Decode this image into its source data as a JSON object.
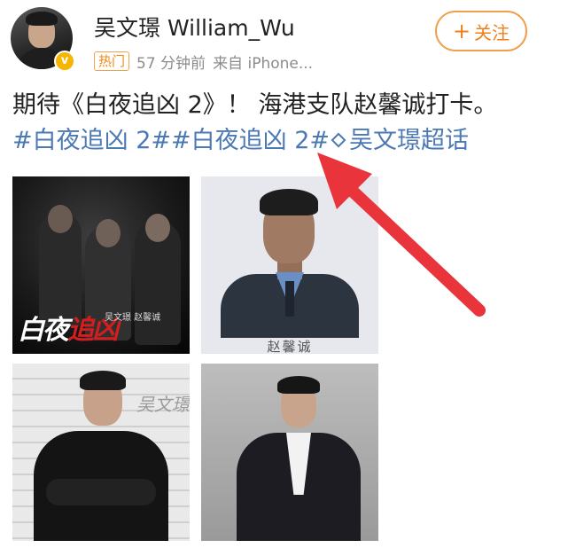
{
  "post": {
    "author": {
      "name": "吴文璟 William_Wu",
      "verified_mark": "v"
    },
    "meta": {
      "hot_badge": "热门",
      "time": "57 分钟前",
      "source": "来自 iPhone..."
    },
    "follow_button": {
      "plus": "+",
      "label": "关注"
    },
    "text": "期待《白夜追凶 2》！ 海港支队赵馨诚打卡。",
    "hashtags": {
      "tag1": "#白夜追凶 2#",
      "tag2": "#白夜追凶 2#",
      "super_topic": "吴文璟超话"
    },
    "images": {
      "image1": {
        "title_white": "白夜",
        "title_red": "追凶",
        "credit": "吴文璟  赵馨诚"
      },
      "image2": {
        "caption": "赵馨诚"
      },
      "image3": {
        "signature": "吴文璟"
      }
    }
  },
  "annotation": {
    "arrow_color": "#e8343a"
  },
  "colors": {
    "accent_orange": "#f07f1a",
    "link_blue": "#4b79b5",
    "verified_gold": "#f7b500"
  }
}
